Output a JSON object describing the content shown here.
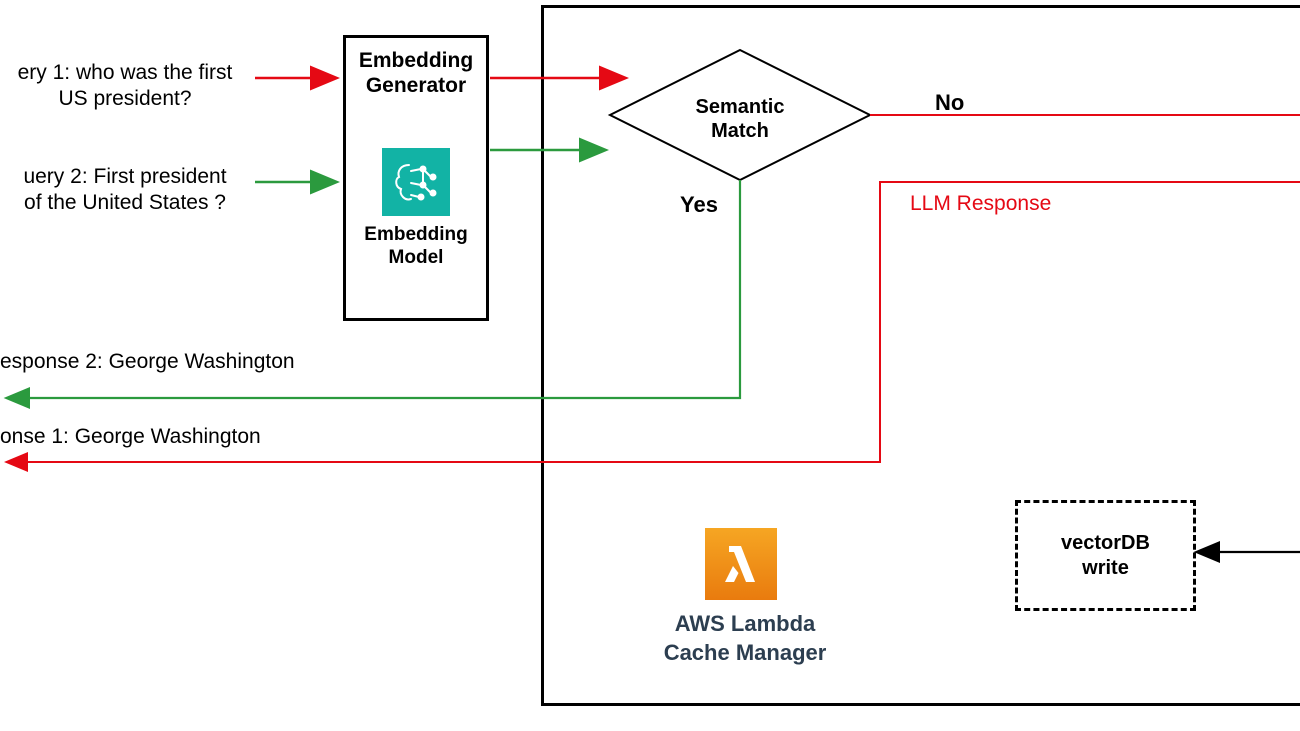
{
  "query1": "ery 1: who was the first\nUS president?",
  "query2": "uery 2: First president\nof the United States ?",
  "embedding": {
    "title": "Embedding\nGenerator",
    "sub": "Embedding\nModel"
  },
  "response2": "esponse 2: George Washington",
  "response1": "onse 1: George Washington",
  "semantic": "Semantic\nMatch",
  "no": "No",
  "yes": "Yes",
  "llm": "LLM Response",
  "lambdaLine1": "AWS Lambda",
  "lambdaLine2": "Cache Manager",
  "vectordb": "vectorDB\nwrite",
  "colors": {
    "red": "#e50914",
    "green": "#2b9a3e",
    "teal": "#12b3a5",
    "orange": "#f08c00"
  }
}
